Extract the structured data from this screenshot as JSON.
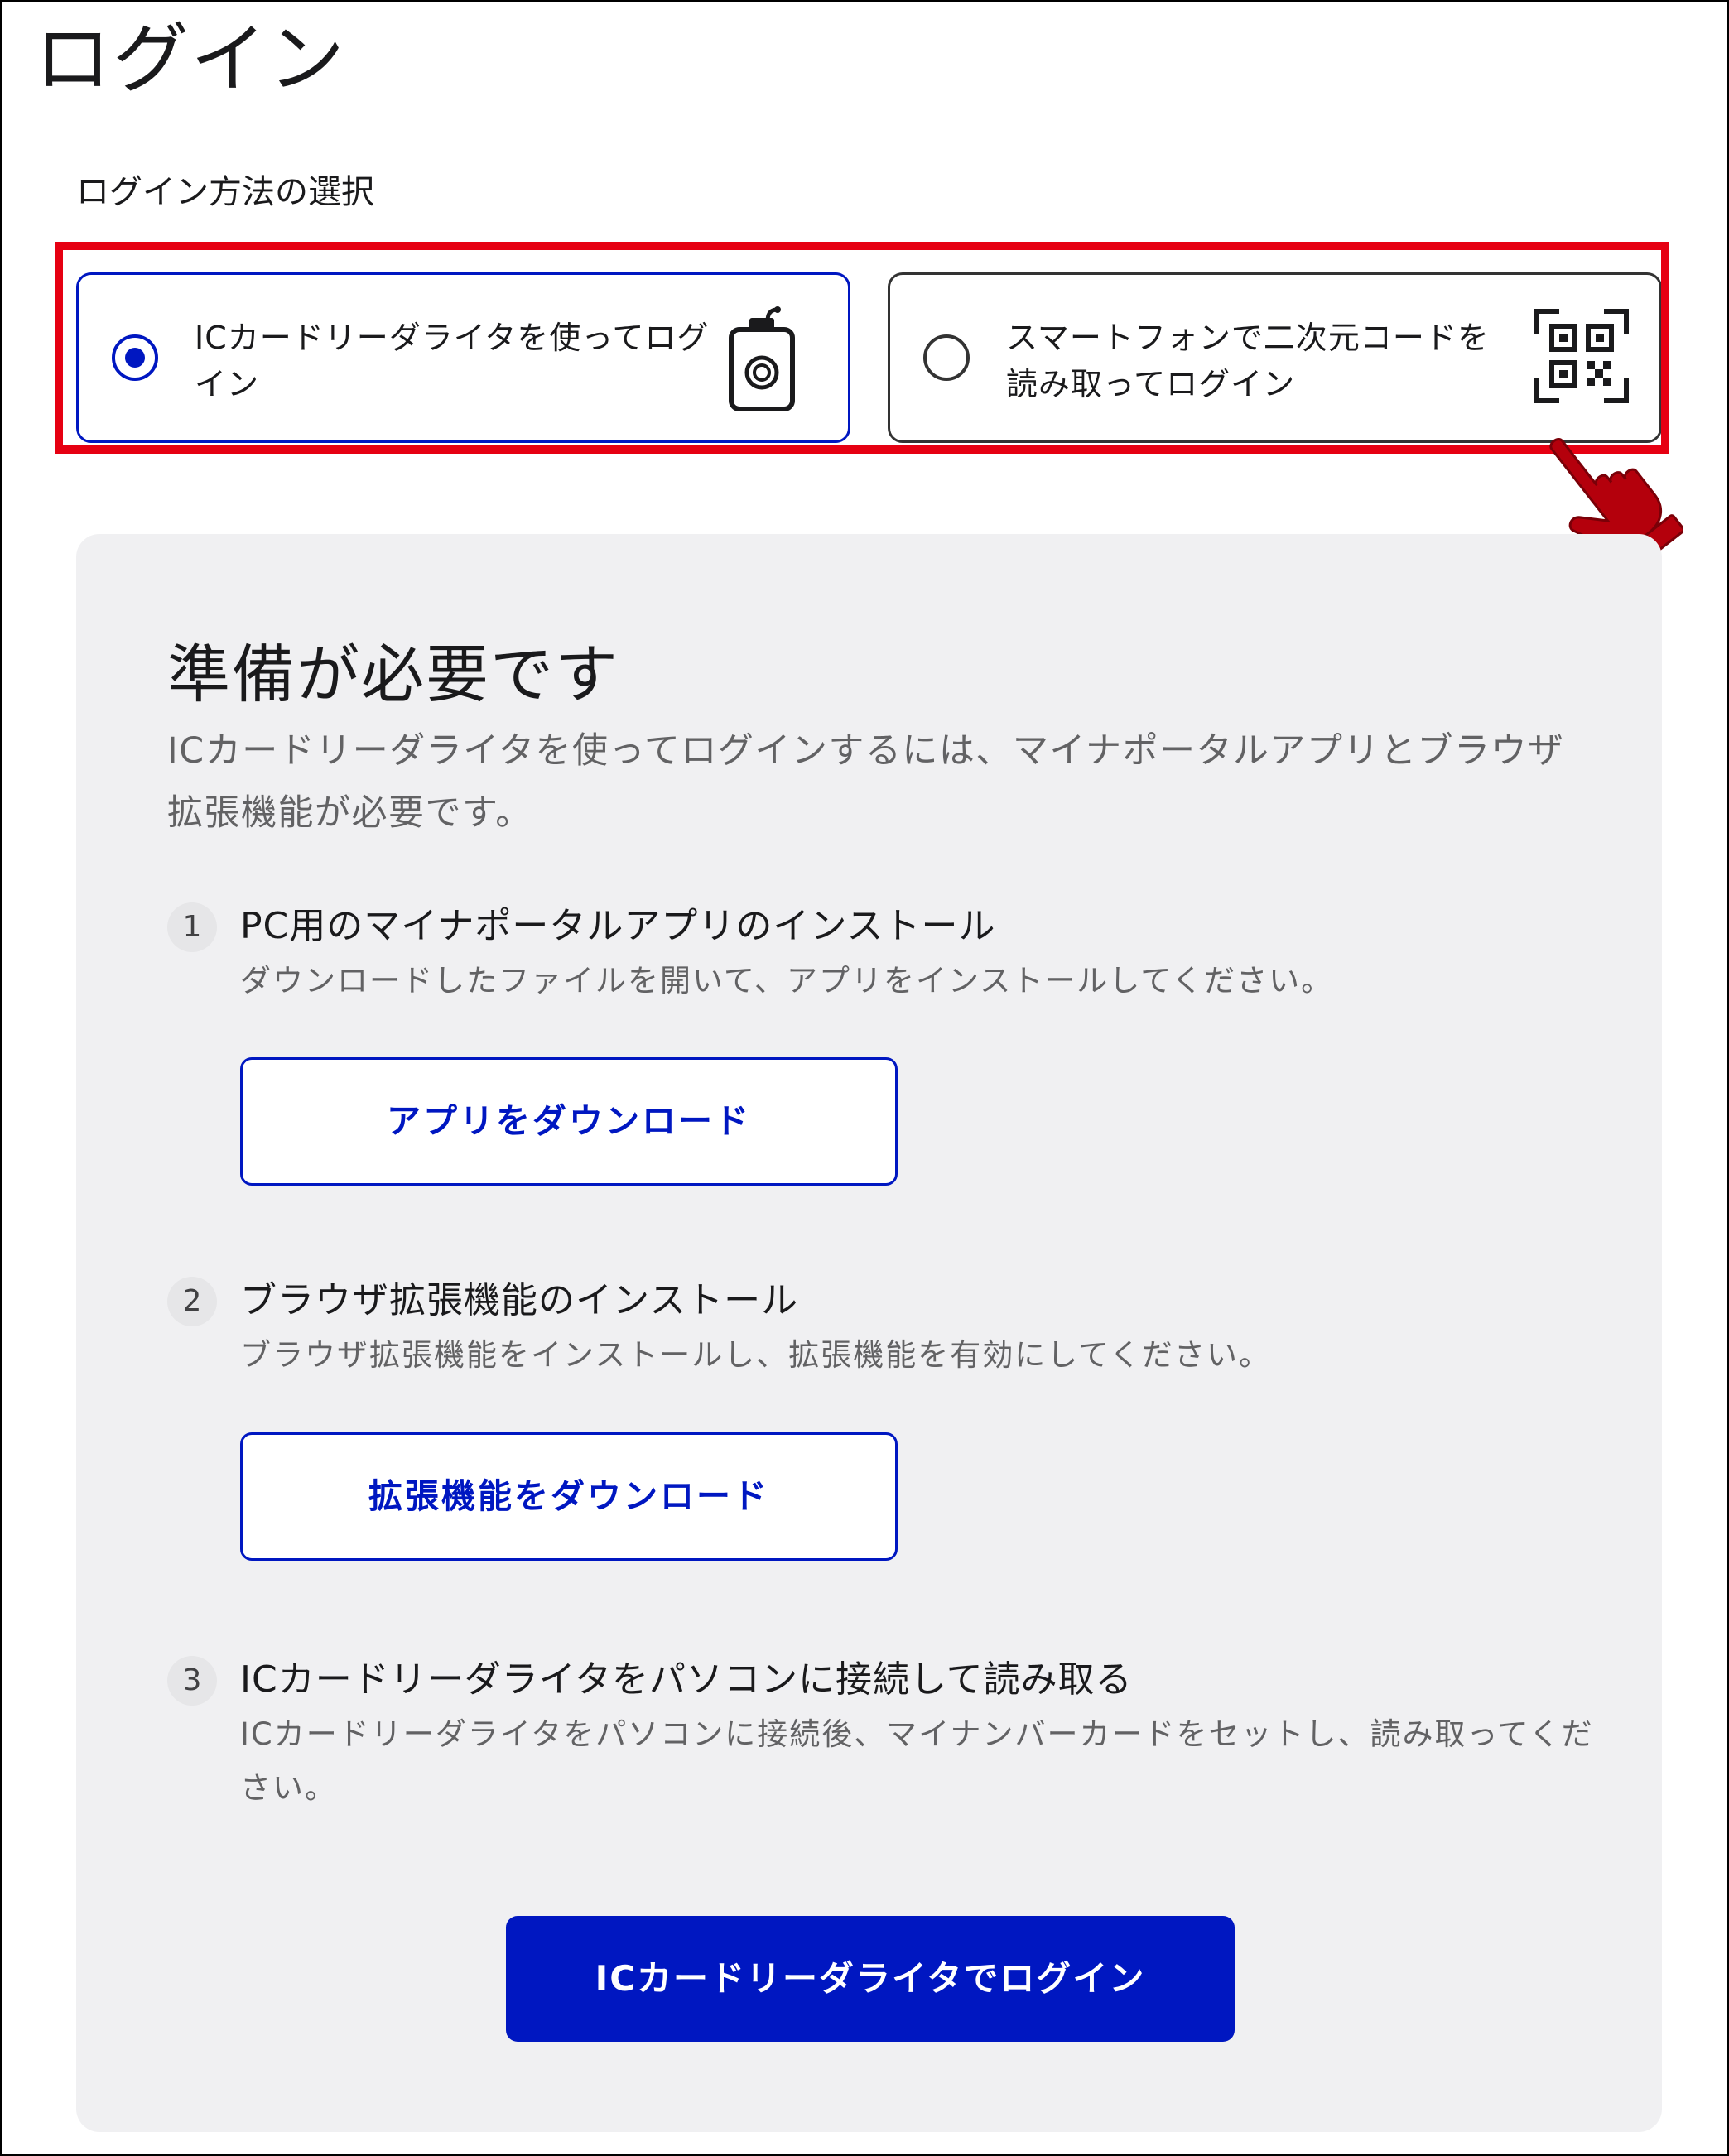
{
  "page": {
    "title": "ログイン"
  },
  "login_method": {
    "label": "ログイン方法の選択",
    "options": [
      {
        "label": "ICカードリーダライタを使ってログイン",
        "selected": true,
        "icon": "card-reader-icon"
      },
      {
        "label": "スマートフォンで二次元コードを読み取ってログイン",
        "selected": false,
        "icon": "qr-code-icon"
      }
    ],
    "highlight_color": "#e60012",
    "pointer_icon": "pointing-hand-icon"
  },
  "preparation": {
    "heading": "準備が必要です",
    "description": "ICカードリーダライタを使ってログインするには、マイナポータルアプリとブラウザ拡張機能が必要です。",
    "steps": [
      {
        "number": "1",
        "title": "PC用のマイナポータルアプリのインストール",
        "description": "ダウンロードしたファイルを開いて、アプリをインストールしてください。",
        "button": "アプリをダウンロード"
      },
      {
        "number": "2",
        "title": "ブラウザ拡張機能のインストール",
        "description": "ブラウザ拡張機能をインストールし、拡張機能を有効にしてください。",
        "button": "拡張機能をダウンロード"
      },
      {
        "number": "3",
        "title": "ICカードリーダライタをパソコンに接続して読み取る",
        "description": "ICカードリーダライタをパソコンに接続後、マイナンバーカードをセットし、読み取ってください。"
      }
    ],
    "submit_button": "ICカードリーダライタでログイン"
  },
  "colors": {
    "accent": "#0017c1",
    "panel_background": "#f0f0f2",
    "annotation": "#e60012"
  }
}
